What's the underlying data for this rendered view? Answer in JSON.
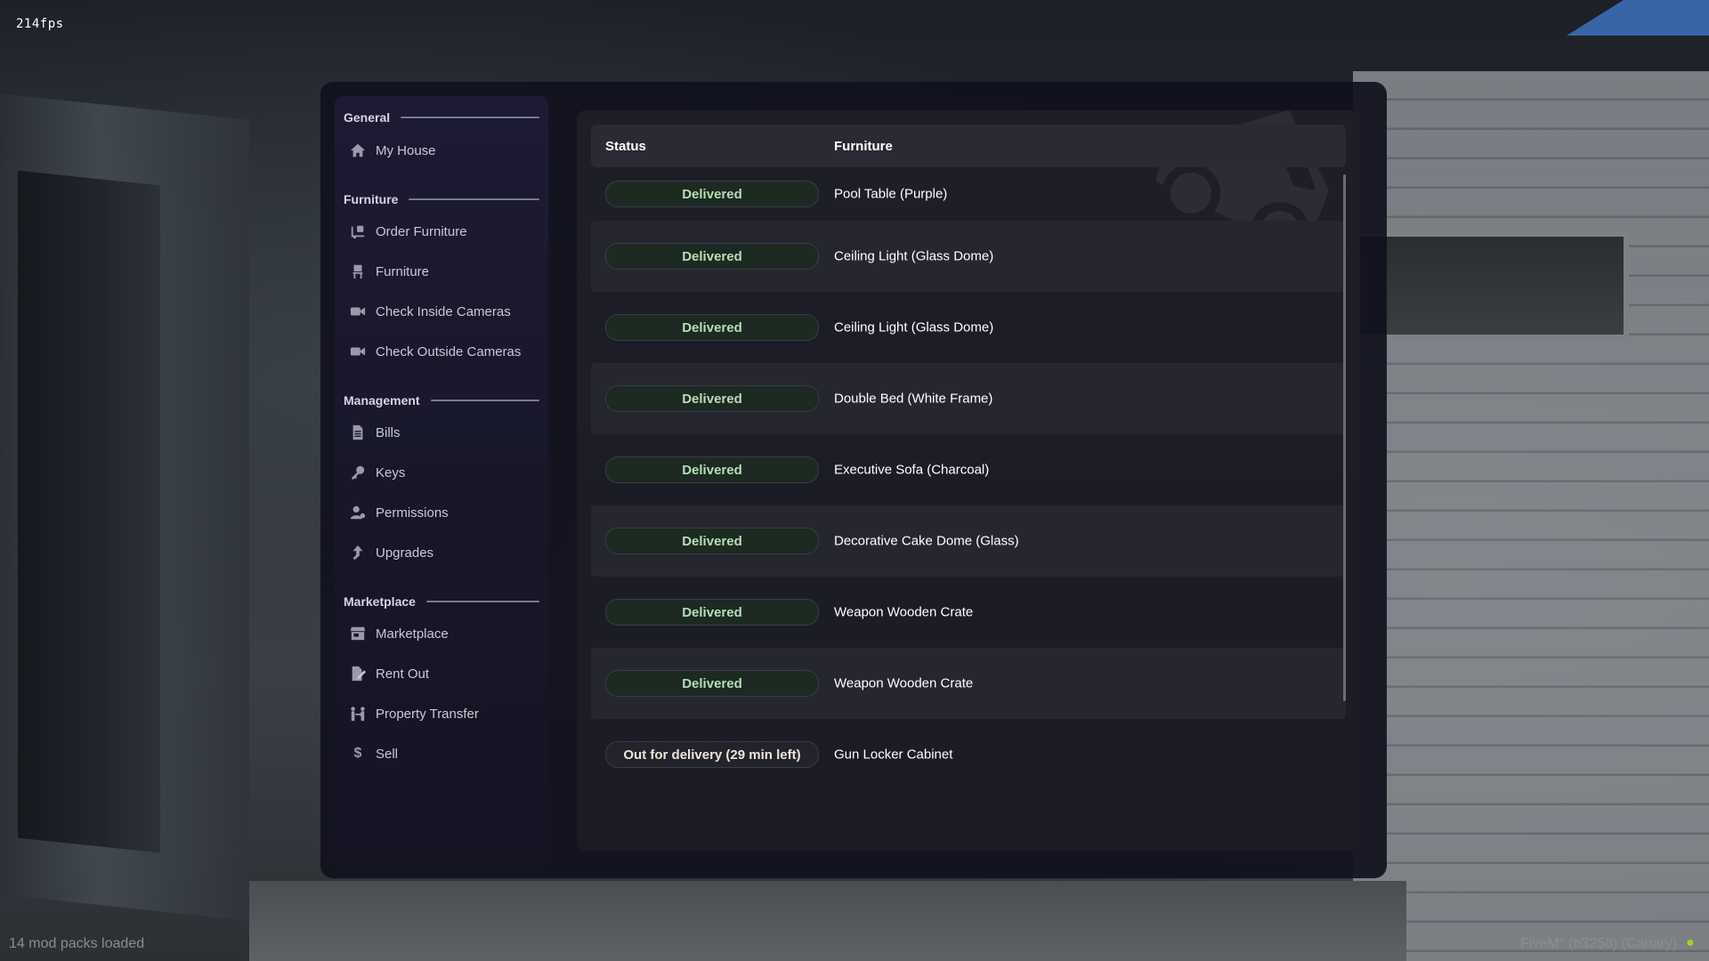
{
  "hud": {
    "fps": "214fps",
    "mods_loaded": "14 mod packs loaded",
    "build": "FiveM* (b3258) (Canary)"
  },
  "sidebar": {
    "sections": [
      {
        "title": "General",
        "items": [
          {
            "label": "My House",
            "icon": "house-icon"
          }
        ]
      },
      {
        "title": "Furniture",
        "items": [
          {
            "label": "Order Furniture",
            "icon": "truck-loading-icon"
          },
          {
            "label": "Furniture",
            "icon": "chair-icon"
          },
          {
            "label": "Check Inside Cameras",
            "icon": "video-camera-icon"
          },
          {
            "label": "Check Outside Cameras",
            "icon": "video-camera-icon"
          }
        ]
      },
      {
        "title": "Management",
        "items": [
          {
            "label": "Bills",
            "icon": "file-invoice-icon"
          },
          {
            "label": "Keys",
            "icon": "key-icon"
          },
          {
            "label": "Permissions",
            "icon": "user-gear-icon"
          },
          {
            "label": "Upgrades",
            "icon": "arrow-up-icon"
          }
        ]
      },
      {
        "title": "Marketplace",
        "items": [
          {
            "label": "Marketplace",
            "icon": "store-icon"
          },
          {
            "label": "Rent Out",
            "icon": "file-signature-icon"
          },
          {
            "label": "Property Transfer",
            "icon": "people-arrows-icon"
          },
          {
            "label": "Sell",
            "icon": "dollar-icon"
          }
        ]
      }
    ]
  },
  "table": {
    "columns": {
      "status": "Status",
      "furniture": "Furniture"
    },
    "rows": [
      {
        "status": "Delivered",
        "furniture": "Pool Table (Purple)"
      },
      {
        "status": "Delivered",
        "furniture": "Ceiling Light (Glass Dome)"
      },
      {
        "status": "Delivered",
        "furniture": "Ceiling Light (Glass Dome)"
      },
      {
        "status": "Delivered",
        "furniture": "Double Bed (White Frame)"
      },
      {
        "status": "Delivered",
        "furniture": "Executive Sofa (Charcoal)"
      },
      {
        "status": "Delivered",
        "furniture": "Decorative Cake Dome (Glass)"
      },
      {
        "status": "Delivered",
        "furniture": "Weapon Wooden Crate"
      },
      {
        "status": "Delivered",
        "furniture": "Weapon Wooden Crate"
      },
      {
        "status": "Out for delivery (29 min left)",
        "furniture": "Gun Locker Cabinet"
      }
    ]
  },
  "colors": {
    "panel_bg": "#11111e",
    "delivered_text": "#b8ddb8",
    "pending_text": "#ece6d6"
  }
}
